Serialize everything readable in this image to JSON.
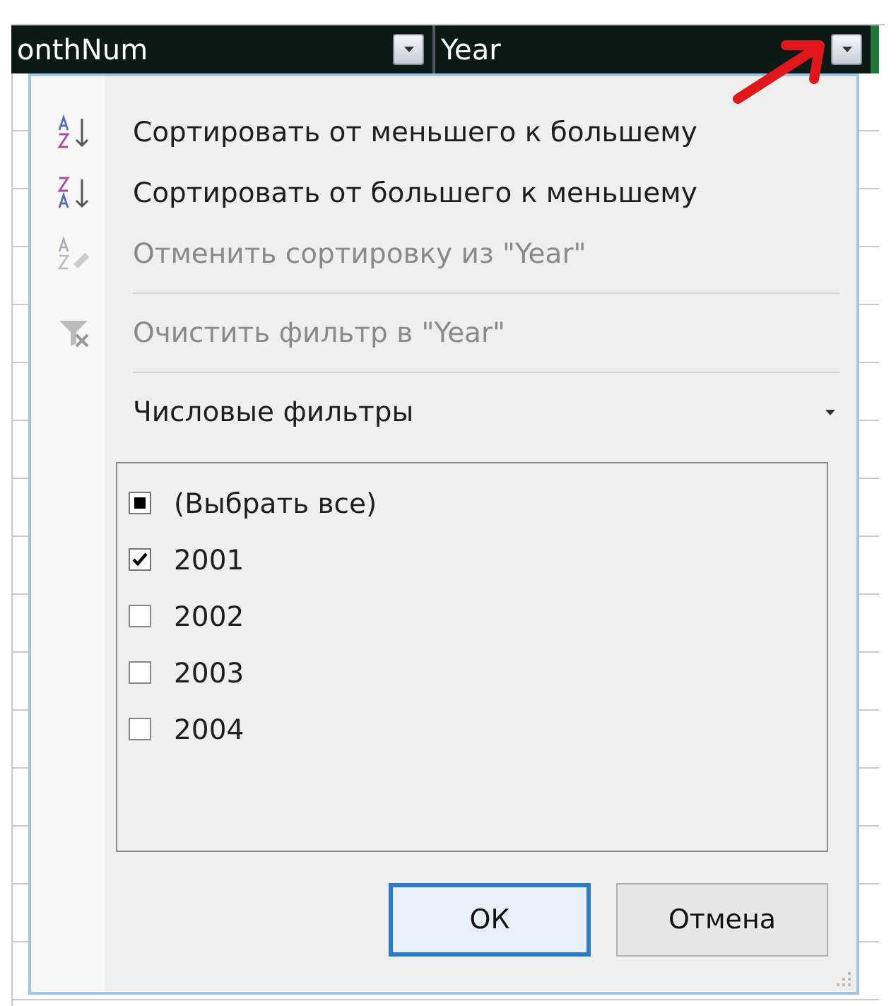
{
  "header_columns": [
    {
      "label": "onthNum"
    },
    {
      "label": "Year"
    }
  ],
  "menu": {
    "items": [
      {
        "kind": "sort-asc",
        "label": "Сортировать от меньшего к большему",
        "disabled": false
      },
      {
        "kind": "sort-desc",
        "label": "Сортировать от большего к меньшему",
        "disabled": false
      },
      {
        "kind": "sort-clear",
        "label": "Отменить сортировку из \"Year\"",
        "disabled": true
      },
      {
        "kind": "separator"
      },
      {
        "kind": "filter-clear",
        "label": "Очистить фильтр в \"Year\"",
        "disabled": true
      },
      {
        "kind": "separator"
      },
      {
        "kind": "submenu",
        "label": "Числовые фильтры",
        "disabled": false
      }
    ],
    "values": [
      {
        "label": "(Выбрать все)",
        "indeterminate": true
      },
      {
        "label": "2001",
        "checked": true,
        "indeterminate": false
      },
      {
        "label": "2002",
        "checked": false,
        "indeterminate": false
      },
      {
        "label": "2003",
        "checked": false,
        "indeterminate": false
      },
      {
        "label": "2004",
        "checked": false,
        "indeterminate": false
      }
    ],
    "buttons": [
      {
        "label": "ОК",
        "default": true
      },
      {
        "label": "Отмена",
        "default": false
      }
    ]
  }
}
